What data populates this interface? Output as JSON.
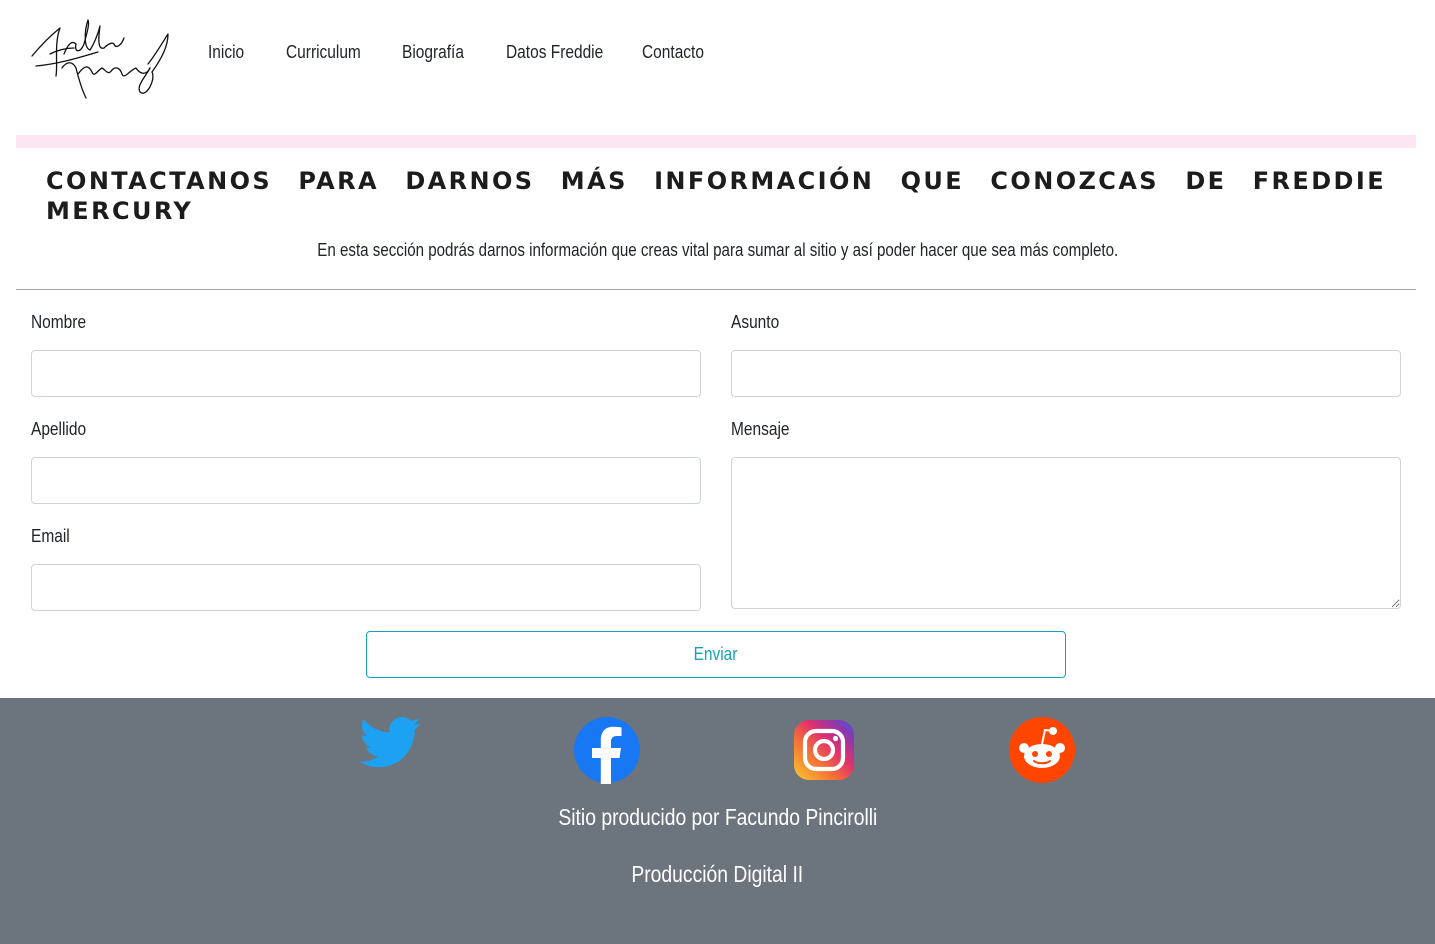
{
  "nav": {
    "logo_icon": "freddie-mercury-signature",
    "links": [
      "Inicio",
      "Curriculum",
      "Biografía",
      "Datos Freddie",
      "Contacto"
    ]
  },
  "header": {
    "title": "Contactanos para darnos más información que conozcas de Freddie Mercury",
    "subtitle": "En esta sección podrás darnos información que creas vital para sumar al sitio y así poder hacer que sea más completo."
  },
  "form": {
    "nombre_label": "Nombre",
    "apellido_label": "Apellido",
    "email_label": "Email",
    "asunto_label": "Asunto",
    "mensaje_label": "Mensaje",
    "nombre_value": "",
    "apellido_value": "",
    "email_value": "",
    "asunto_value": "",
    "mensaje_value": "",
    "submit_label": "Enviar"
  },
  "footer": {
    "social_icons": [
      "twitter-icon",
      "facebook-icon",
      "instagram-icon",
      "reddit-icon"
    ],
    "credit": "Sitio producido por Facundo Pincirolli",
    "course": "Producción Digital II"
  },
  "colors": {
    "accent": "#17a2b8",
    "footer_bg": "#6c757d",
    "pink_band": "#fde6f3",
    "twitter": "#1da1f2",
    "facebook": "#1877f2",
    "reddit": "#ff4500"
  }
}
